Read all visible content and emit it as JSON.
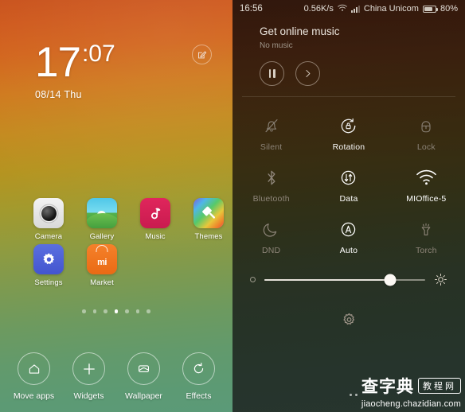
{
  "lockscreen": {
    "clock": {
      "hours": "17",
      "minutes": ":07",
      "date": "08/14  Thu"
    },
    "edit_icon": "compose-edit-icon",
    "apps": [
      {
        "label": "Camera",
        "icon": "camera-app-icon"
      },
      {
        "label": "Gallery",
        "icon": "gallery-app-icon"
      },
      {
        "label": "Music",
        "icon": "music-app-icon"
      },
      {
        "label": "Themes",
        "icon": "themes-app-icon"
      },
      {
        "label": "Settings",
        "icon": "settings-app-icon"
      },
      {
        "label": "Market",
        "icon": "market-app-icon",
        "wordmark": "mi"
      }
    ],
    "page_dots": {
      "count": 7,
      "active_index": 3
    },
    "dock": [
      {
        "label": "Move apps",
        "icon": "home-outline-icon"
      },
      {
        "label": "Widgets",
        "icon": "plus-icon"
      },
      {
        "label": "Wallpaper",
        "icon": "wallpaper-image-icon"
      },
      {
        "label": "Effects",
        "icon": "refresh-circle-icon"
      }
    ]
  },
  "shade": {
    "statusbar": {
      "time": "16:56",
      "net_speed": "0.56K/s",
      "wifi_icon": "wifi-icon",
      "signal_icon": "cellular-signal-icon",
      "carrier": "China Unicom",
      "battery_icon": "battery-icon",
      "battery_level": 80,
      "battery_percent": "80%"
    },
    "music": {
      "title": "Get online music",
      "subtitle": "No music",
      "pause_icon": "pause-icon",
      "next_icon": "next-chevron-icon"
    },
    "toggles": [
      [
        {
          "label": "Silent",
          "icon": "bell-muted-icon",
          "state": "off"
        },
        {
          "label": "Rotation",
          "icon": "rotation-lock-icon",
          "state": "on"
        },
        {
          "label": "Lock",
          "icon": "padlock-icon",
          "state": "off"
        }
      ],
      [
        {
          "label": "Bluetooth",
          "icon": "bluetooth-icon",
          "state": "off"
        },
        {
          "label": "Data",
          "icon": "mobile-data-icon",
          "state": "on"
        },
        {
          "label": "MIOffice-5",
          "icon": "wifi-icon",
          "state": "on"
        }
      ],
      [
        {
          "label": "DND",
          "icon": "moon-icon",
          "state": "off"
        },
        {
          "label": "Auto",
          "icon": "auto-brightness-icon",
          "state": "on"
        },
        {
          "label": "Torch",
          "icon": "flashlight-icon",
          "state": "off"
        }
      ]
    ],
    "brightness": {
      "value": 78,
      "min_icon": "brightness-low-icon",
      "max_icon": "brightness-high-sun-icon"
    },
    "settings_gear_icon": "gear-icon"
  },
  "watermark": {
    "brand_cn": "查字典",
    "badge_cn": "教程网",
    "url": "jiaocheng.chazidian.com"
  },
  "colors": {
    "accent_white": "#ffffff",
    "toggle_off": "#8e8579",
    "left_gradient_start": "#c9521c",
    "left_gradient_end": "#5b9a78",
    "right_gradient_start": "#3d1d10",
    "right_gradient_end": "#27352e"
  }
}
